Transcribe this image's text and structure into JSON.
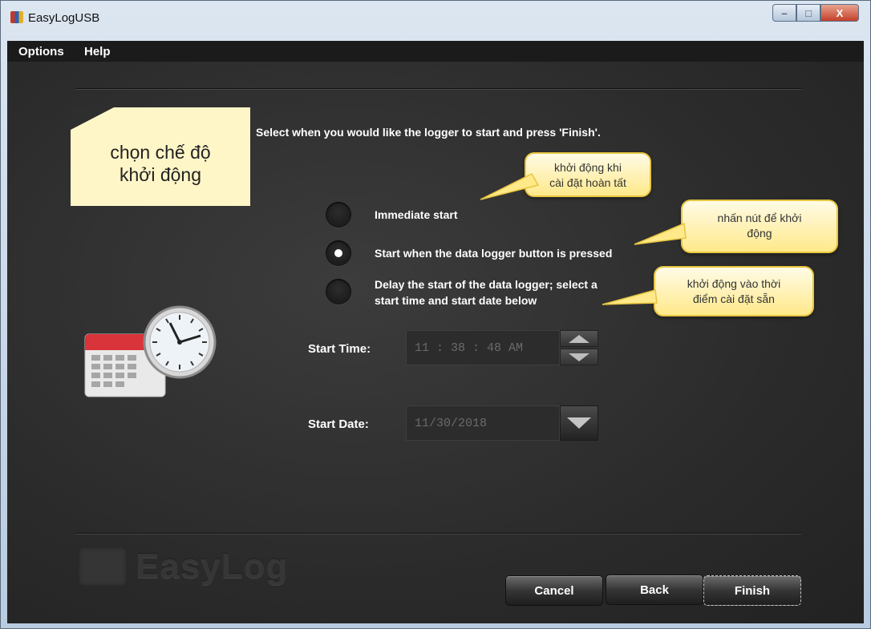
{
  "window": {
    "title": "EasyLogUSB",
    "minimize": "–",
    "maximize": "□",
    "close": "X"
  },
  "menu": {
    "items": [
      "Options",
      "Help"
    ]
  },
  "note": {
    "line1": "chọn chế độ",
    "line2": "khởi động"
  },
  "instruction": "Select when you would like the logger to start and press 'Finish'.",
  "options": [
    {
      "line1": "Immediate start",
      "line2": "",
      "selected": false
    },
    {
      "line1": "Start when the data logger button is pressed",
      "line2": "",
      "selected": true
    },
    {
      "line1": "Delay the start of the data logger; select a",
      "line2": "start time and start date below",
      "selected": false
    }
  ],
  "callouts": [
    {
      "line1": "khởi động khi",
      "line2": "cài đặt hoàn tất"
    },
    {
      "line1": "nhấn nút để khởi",
      "line2": "động"
    },
    {
      "line1": "khởi động vào thời",
      "line2": "điểm cài đặt sẵn"
    }
  ],
  "start_time": {
    "label": "Start Time:",
    "value": "11 : 38 : 48 AM"
  },
  "start_date": {
    "label": "Start Date:",
    "value": "11/30/2018"
  },
  "brand": "EasyLog",
  "buttons": {
    "cancel": "Cancel",
    "back": "Back",
    "finish": "Finish"
  },
  "icons": [
    "calendar-icon",
    "clock-icon",
    "easylog-logo-icon",
    "app-icon"
  ]
}
